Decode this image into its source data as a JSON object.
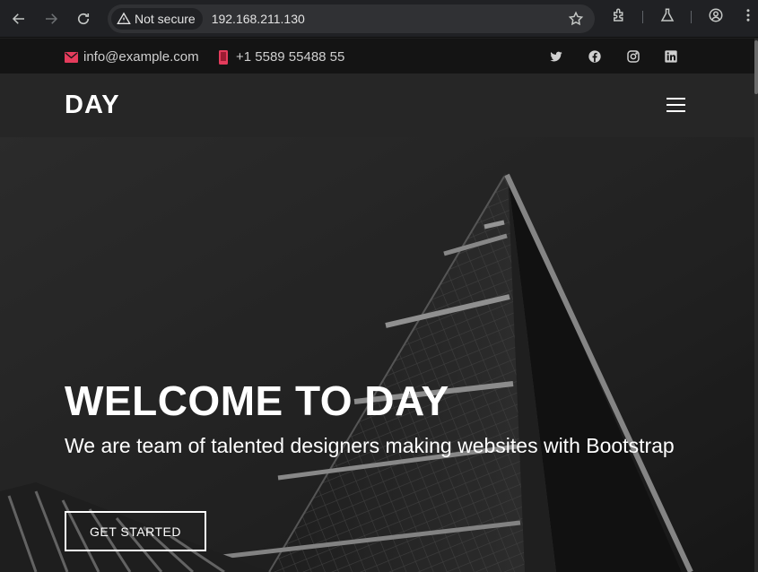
{
  "browser": {
    "security_label": "Not secure",
    "url": "192.168.211.130"
  },
  "topbar": {
    "email": "info@example.com",
    "phone": "+1 5589 55488 55",
    "social_icons": [
      "twitter-icon",
      "facebook-icon",
      "instagram-icon",
      "linkedin-icon"
    ]
  },
  "header": {
    "logo": "DAY"
  },
  "hero": {
    "title": "WELCOME TO DAY",
    "subtitle": "We are team of talented designers making websites with Bootstrap",
    "cta_label": "GET STARTED"
  },
  "colors": {
    "accent_red": "#e43c5c",
    "topbar_bg": "#141414",
    "header_bg": "#262626",
    "chrome_bg": "#202124"
  }
}
